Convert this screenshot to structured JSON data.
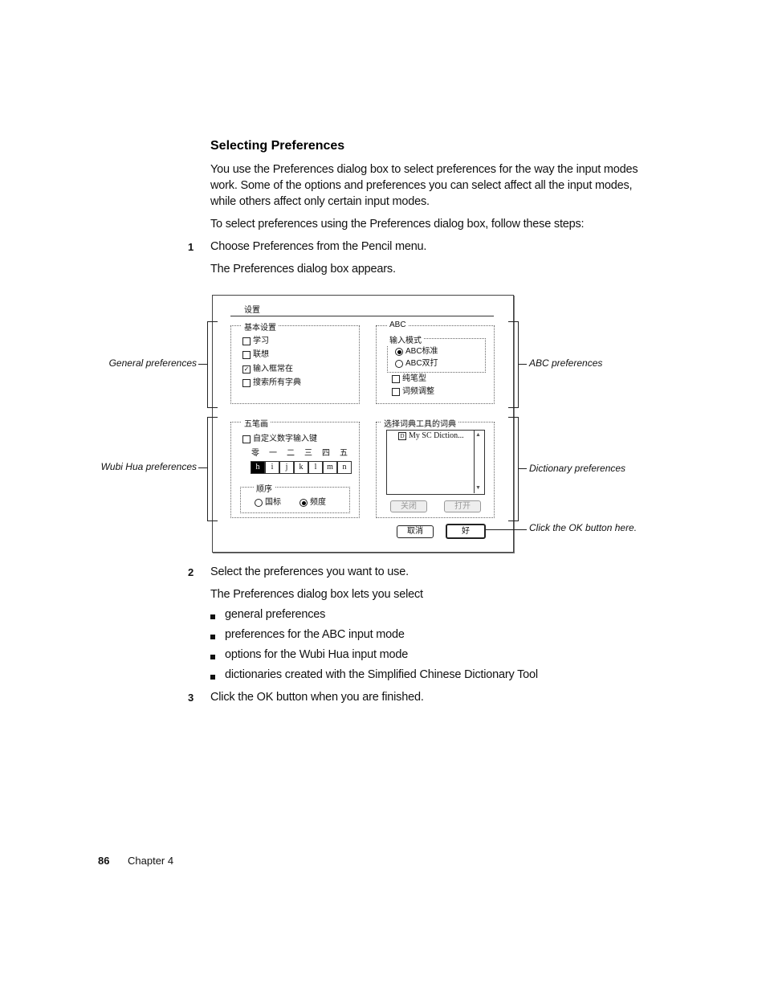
{
  "section": {
    "heading": "Selecting Preferences",
    "intro": "You use the Preferences dialog box to select preferences for the way the input modes work. Some of the options and preferences you can select affect all the input modes, while others affect only certain input modes.",
    "steps_intro": "To select preferences using the Preferences dialog box, follow these steps:"
  },
  "steps": [
    {
      "num": "1",
      "text": "Choose Preferences from the Pencil menu.",
      "note": "The Preferences dialog box appears."
    },
    {
      "num": "2",
      "text": "Select the preferences you want to use.",
      "note": "The Preferences dialog box lets you select"
    },
    {
      "num": "3",
      "text": "Click the OK button when you are finished."
    }
  ],
  "bullets": [
    "general preferences",
    "preferences for the ABC input mode",
    "options for the Wubi Hua input mode",
    "dictionaries created with the Simplified Chinese Dictionary Tool"
  ],
  "dialog": {
    "title": "设置",
    "general": {
      "label": "基本设置",
      "options": [
        {
          "label": "学习",
          "checked": false
        },
        {
          "label": "联想",
          "checked": false
        },
        {
          "label": "输入框常在",
          "checked": true
        },
        {
          "label": "搜索所有字典",
          "checked": false
        }
      ]
    },
    "abc": {
      "label": "ABC",
      "mode_label": "输入模式",
      "modes": [
        {
          "label": "ABC标准",
          "selected": true
        },
        {
          "label": "ABC双打",
          "selected": false
        }
      ],
      "options": [
        {
          "label": "纯笔型",
          "checked": false
        },
        {
          "label": "词频调整",
          "checked": false
        }
      ]
    },
    "wubi": {
      "label": "五笔画",
      "custom_label": "自定义数字输入键",
      "digits": [
        "零",
        "一",
        "二",
        "三",
        "四",
        "五"
      ],
      "keys": [
        "h",
        "i",
        "j",
        "k",
        "l",
        "m",
        "n"
      ],
      "order_label": "顺序",
      "order": [
        {
          "label": "国标",
          "selected": false
        },
        {
          "label": "频度",
          "selected": true
        }
      ]
    },
    "dict": {
      "label": "选择词典工具的词典",
      "items": [
        "My SC Diction..."
      ],
      "close_label": "关闭",
      "open_label": "打开"
    },
    "cancel_label": "取消",
    "ok_label": "好"
  },
  "callouts": {
    "general": "General preferences",
    "abc": "ABC preferences",
    "wubi": "Wubi Hua preferences",
    "dict": "Dictionary preferences",
    "ok": "Click the OK button here."
  },
  "footer": {
    "page_number": "86",
    "chapter": "Chapter 4"
  }
}
